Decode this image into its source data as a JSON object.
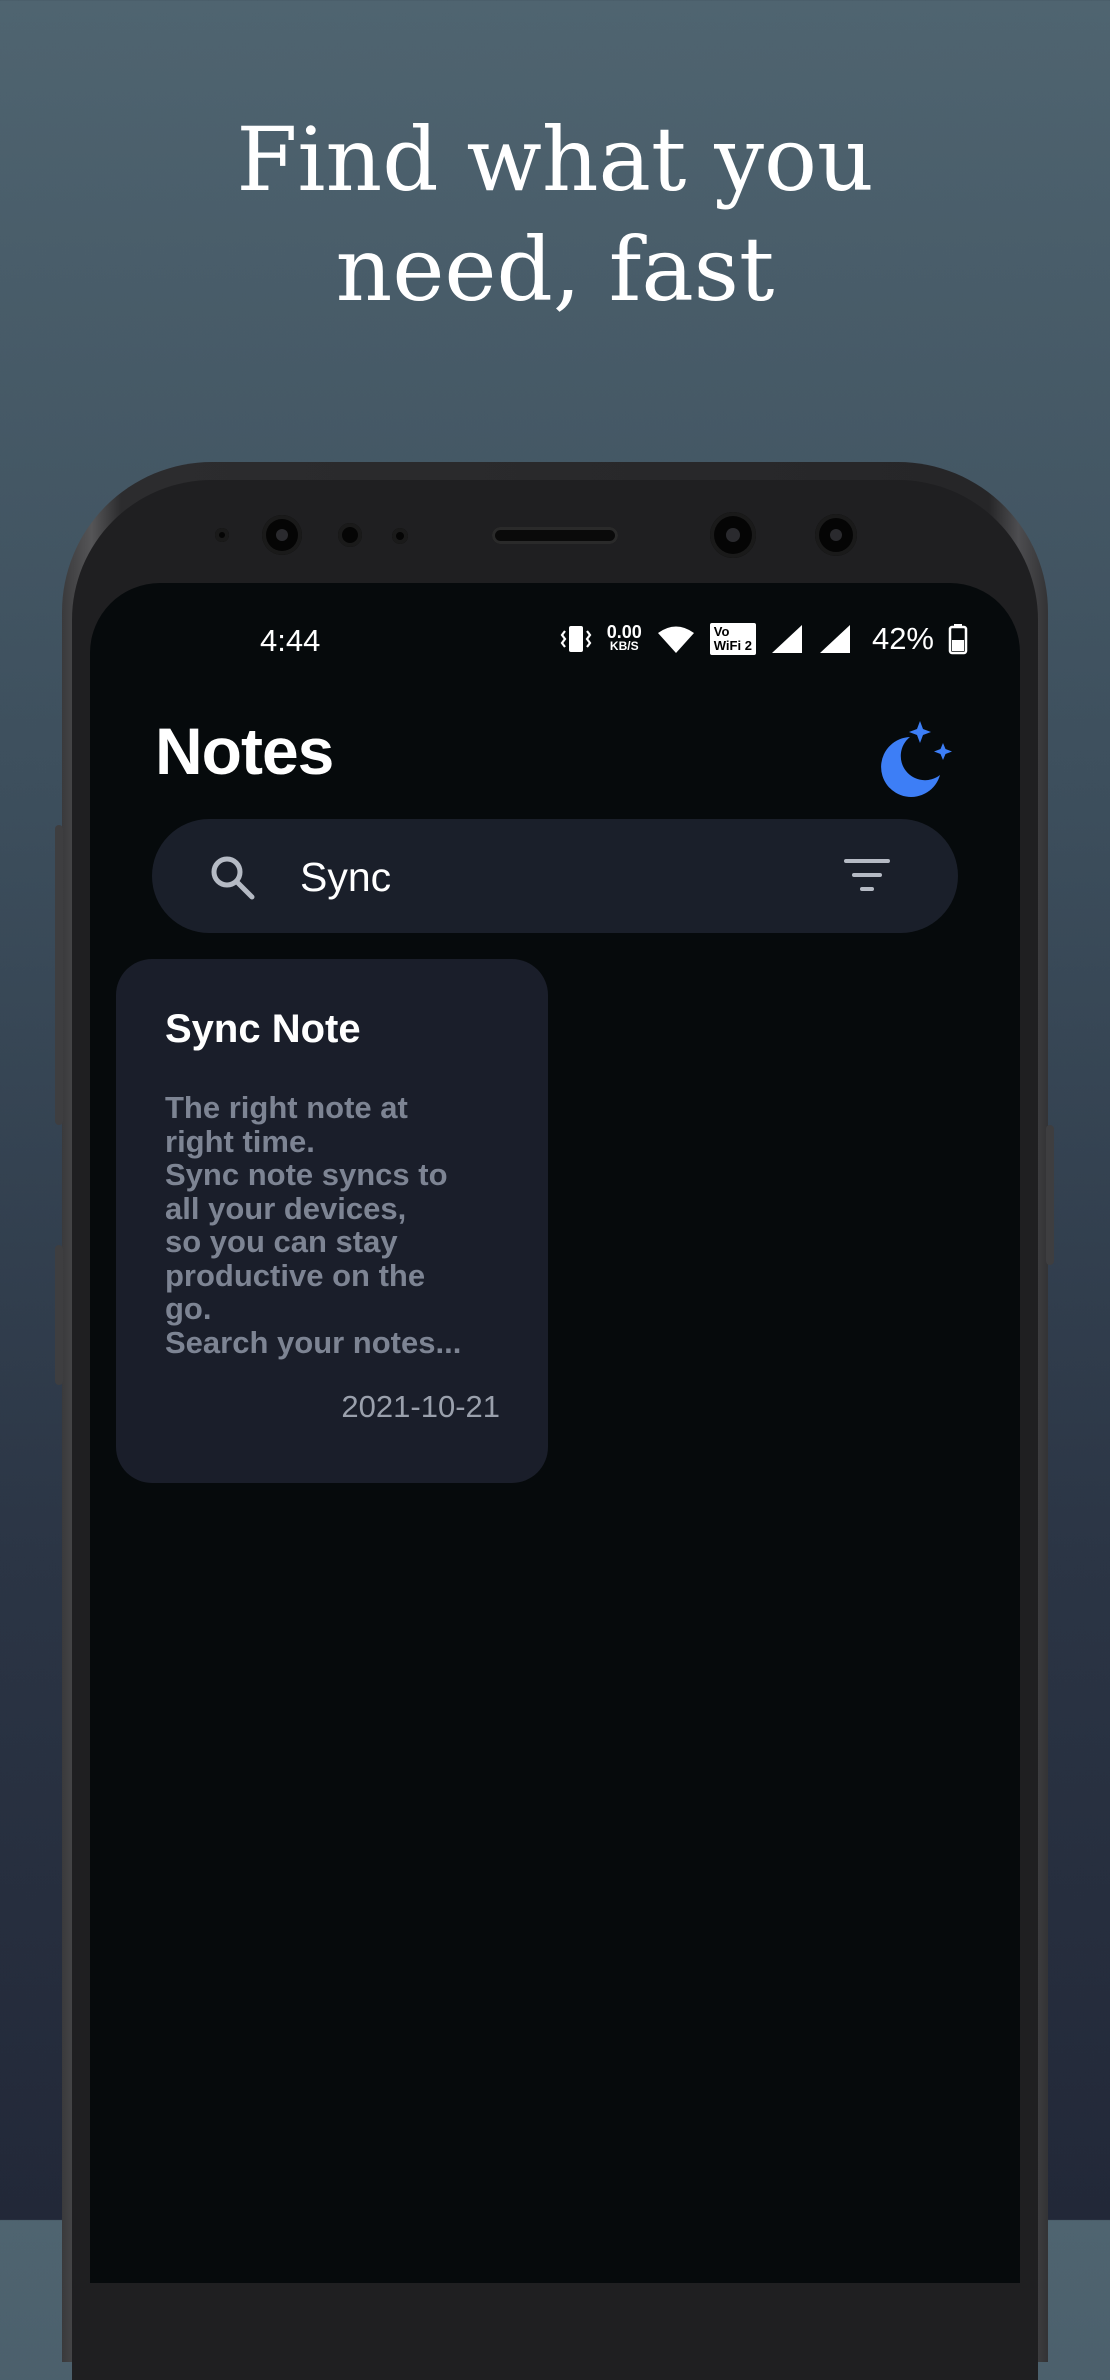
{
  "headline": {
    "line1": "Find what you",
    "line2": "need, fast"
  },
  "status_bar": {
    "time": "4:44",
    "net_speed_value": "0.00",
    "net_speed_unit": "KB/S",
    "vowifi_top": "Vo",
    "vowifi_bottom": "WiFi 2",
    "battery_percent": "42%"
  },
  "app": {
    "title": "Notes",
    "theme_toggle_icon": "moon-stars-icon",
    "accent_color": "#3d7ef6"
  },
  "search": {
    "value": "Sync",
    "placeholder": ""
  },
  "notes": [
    {
      "title": "Sync Note",
      "body": "The right note at\nright time.\nSync note syncs to\nall your devices,\nso you can stay\nproductive on the\ngo.\nSearch your notes...",
      "date": "2021-10-21"
    }
  ]
}
